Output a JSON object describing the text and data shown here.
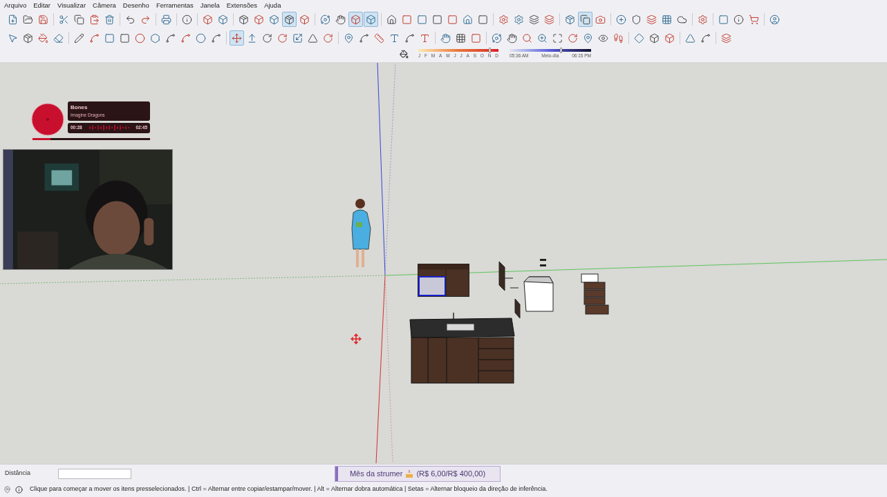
{
  "menu": [
    "Arquivo",
    "Editar",
    "Visualizar",
    "Câmera",
    "Desenho",
    "Ferramentas",
    "Janela",
    "Extensões",
    "Ajuda"
  ],
  "toolbar_1": [
    {
      "selected": false
    },
    {
      "selected": false
    },
    {
      "selected": false
    },
    {
      "selected": false
    },
    {
      "selected": false
    },
    {
      "selected": false
    },
    {
      "selected": false
    },
    {
      "selected": false
    },
    {
      "selected": false
    },
    {
      "selected": false
    },
    {
      "selected": false
    },
    {
      "selected": false
    },
    {
      "selected": false
    },
    {
      "selected": false
    },
    {
      "selected": false
    },
    {
      "selected": false
    },
    {
      "selected": true
    },
    {
      "selected": false
    },
    {
      "selected": false
    },
    {
      "selected": false
    },
    {
      "selected": true
    },
    {
      "selected": true
    },
    {
      "selected": false
    },
    {
      "selected": false
    },
    {
      "selected": false
    },
    {
      "selected": false
    },
    {
      "selected": false
    },
    {
      "selected": false
    },
    {
      "selected": false
    },
    {
      "selected": false
    },
    {
      "selected": false
    },
    {
      "selected": false
    },
    {
      "selected": false
    },
    {
      "selected": false
    },
    {
      "selected": true
    },
    {
      "selected": false
    },
    {
      "selected": false
    },
    {
      "selected": false
    },
    {
      "selected": false
    },
    {
      "selected": false
    },
    {
      "selected": false
    },
    {
      "selected": false
    },
    {
      "selected": false
    },
    {
      "selected": false
    },
    {
      "selected": false
    },
    {
      "selected": false
    }
  ],
  "toolbar_2": [
    {
      "selected": false
    },
    {
      "selected": false
    },
    {
      "selected": false
    },
    {
      "selected": false
    },
    {
      "selected": false
    },
    {
      "selected": false
    },
    {
      "selected": false
    },
    {
      "selected": false
    },
    {
      "selected": false
    },
    {
      "selected": false
    },
    {
      "selected": false
    },
    {
      "selected": false
    },
    {
      "selected": false
    },
    {
      "selected": false
    },
    {
      "selected": true
    },
    {
      "selected": false
    },
    {
      "selected": false
    },
    {
      "selected": false
    },
    {
      "selected": false
    },
    {
      "selected": false
    },
    {
      "selected": false
    },
    {
      "selected": false
    },
    {
      "selected": false
    },
    {
      "selected": false
    },
    {
      "selected": false
    },
    {
      "selected": false
    },
    {
      "selected": false
    },
    {
      "selected": false
    },
    {
      "selected": false
    },
    {
      "selected": false
    },
    {
      "selected": false
    },
    {
      "selected": false
    },
    {
      "selected": false
    },
    {
      "selected": false
    },
    {
      "selected": false
    },
    {
      "selected": false
    },
    {
      "selected": false
    },
    {
      "selected": false
    },
    {
      "selected": false
    },
    {
      "selected": false
    },
    {
      "selected": false
    },
    {
      "selected": false
    },
    {
      "selected": false
    },
    {
      "selected": false
    },
    {
      "selected": false
    }
  ],
  "shadows": {
    "months": [
      "J",
      "F",
      "M",
      "A",
      "M",
      "J",
      "J",
      "A",
      "S",
      "O",
      "N",
      "D"
    ],
    "date_slider": {
      "level": 0.88
    },
    "times": [
      "05:36 AM",
      "Meio-dia",
      "06:15 PM"
    ],
    "time_slider": {
      "level": 0.62
    }
  },
  "music": {
    "title": "Bones",
    "artist": "Imagine Dragons",
    "elapsed": "00:28",
    "total": "02:45",
    "level": 0.15
  },
  "measurements": {
    "label": "Distância"
  },
  "goal": {
    "label": "Mês da strumer",
    "amount": "(R$ 6,00/R$ 400,00)",
    "level": 0.015
  },
  "status_text": "Clique para começar a mover os itens presselecionados. | Ctrl = Alternar entre copiar/estampar/mover. | Alt = Alternar dobra automática | Setas = Alternar bloqueio da direção de inferência."
}
